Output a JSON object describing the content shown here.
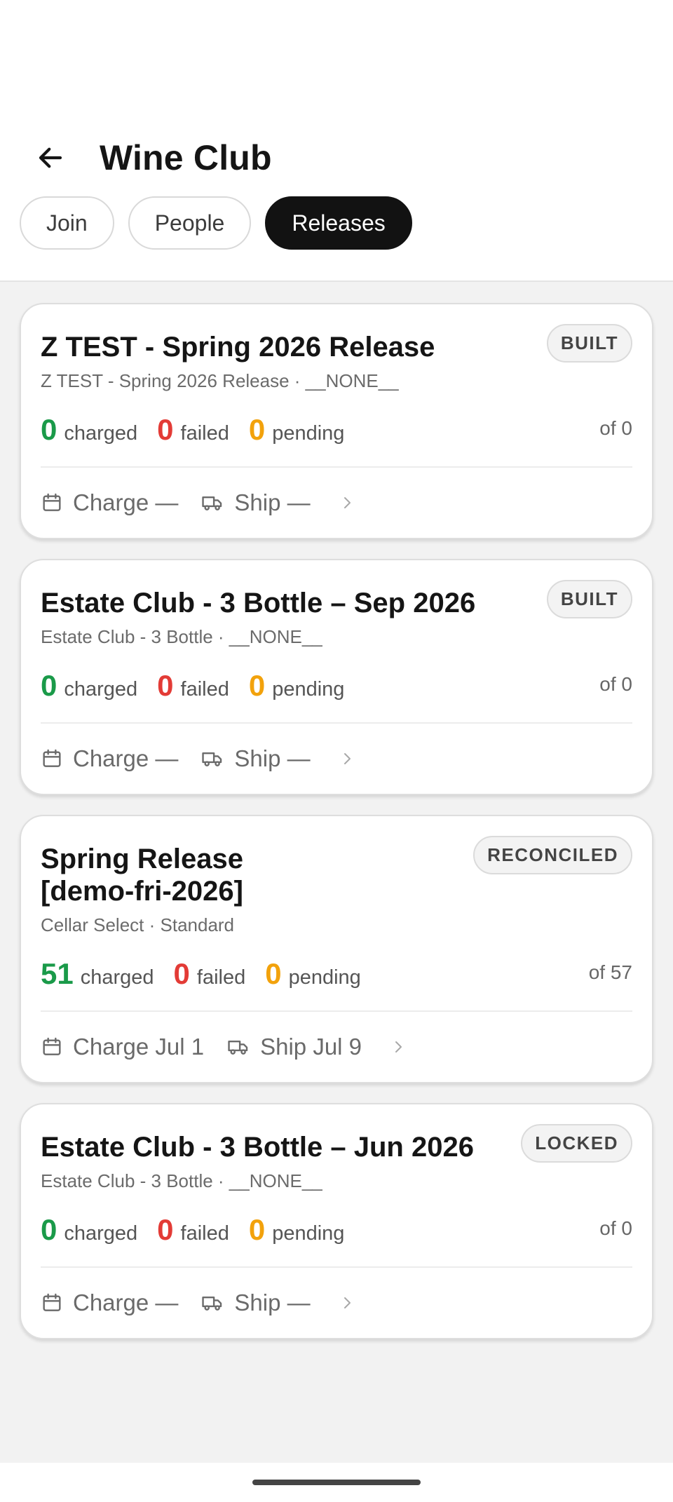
{
  "header": {
    "title": "Wine Club",
    "tabs": [
      {
        "label": "Join"
      },
      {
        "label": "People"
      },
      {
        "label": "Releases"
      }
    ]
  },
  "releases": [
    {
      "title": "Z TEST - Spring 2026 Release",
      "status": "BUILT",
      "subtitle": "Z TEST - Spring 2026 Release · __NONE__",
      "charged": "0",
      "charged_label": "charged",
      "failed": "0",
      "failed_label": "failed",
      "pending": "0",
      "pending_label": "pending",
      "total": "of 0",
      "charge": "Charge —",
      "ship": "Ship —"
    },
    {
      "title": "Estate Club - 3 Bottle – Sep 2026",
      "status": "BUILT",
      "subtitle": "Estate Club - 3 Bottle · __NONE__",
      "charged": "0",
      "charged_label": "charged",
      "failed": "0",
      "failed_label": "failed",
      "pending": "0",
      "pending_label": "pending",
      "total": "of 0",
      "charge": "Charge —",
      "ship": "Ship —"
    },
    {
      "title": "Spring Release [demo-fri-2026]",
      "status": "RECONCILED",
      "subtitle": "Cellar Select · Standard",
      "charged": "51",
      "charged_label": "charged",
      "failed": "0",
      "failed_label": "failed",
      "pending": "0",
      "pending_label": "pending",
      "total": "of 57",
      "charge": "Charge Jul 1",
      "ship": "Ship Jul 9"
    },
    {
      "title": "Estate Club - 3 Bottle – Jun 2026",
      "status": "LOCKED",
      "subtitle": "Estate Club - 3 Bottle · __NONE__",
      "charged": "0",
      "charged_label": "charged",
      "failed": "0",
      "failed_label": "failed",
      "pending": "0",
      "pending_label": "pending",
      "total": "of 0",
      "charge": "Charge —",
      "ship": "Ship —"
    }
  ],
  "colors": {
    "charged": "#1a9a49",
    "failed": "#e33b36",
    "pending": "#f2a20c",
    "active_tab": "#121212"
  },
  "icons": [
    "back-arrow-icon",
    "calendar-icon",
    "truck-icon",
    "chevron-right-icon"
  ]
}
